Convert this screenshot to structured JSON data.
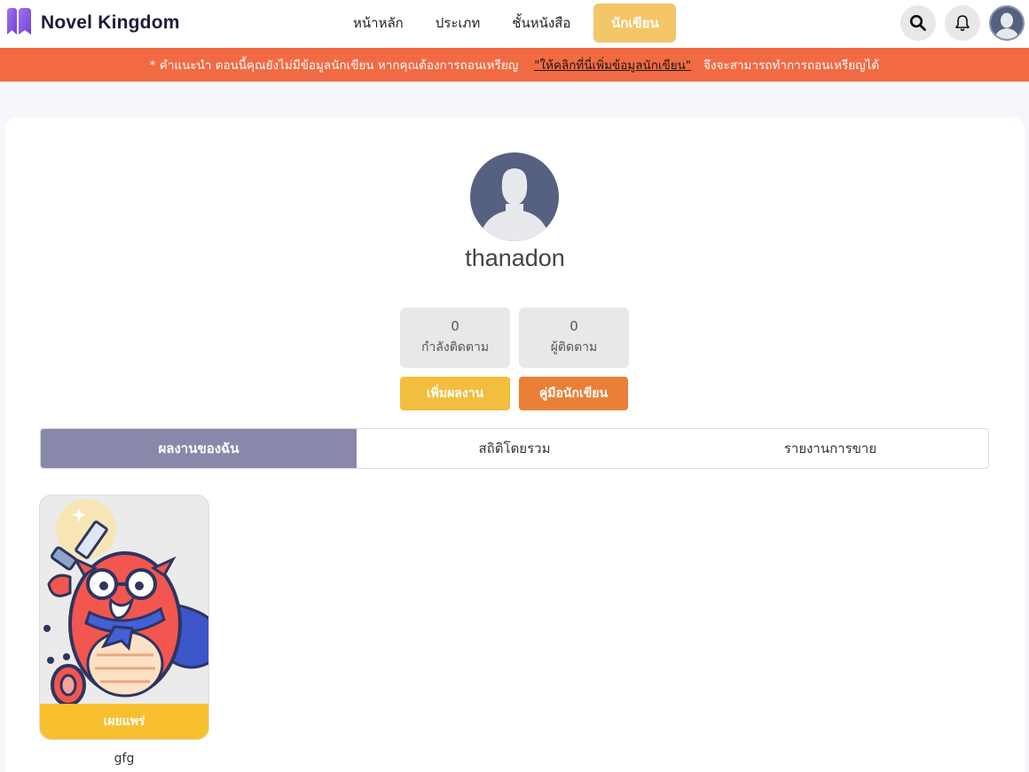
{
  "brand": {
    "name": "Novel Kingdom"
  },
  "nav": {
    "items": [
      {
        "label": "หน้าหลัก"
      },
      {
        "label": "ประเภท"
      },
      {
        "label": "ชั้นหนังสือ"
      },
      {
        "label": "นักเขียน"
      }
    ],
    "active_index": 3
  },
  "header_icons": [
    "search-icon",
    "bell-icon",
    "avatar"
  ],
  "notice": {
    "prefix": "* คำแนะนำ ตอนนี้คุณยังไม่มีข้อมูลนักเขียน หากคุณต้องการถอนเหรียญ",
    "link": "\"ให้คลิกที่นี่เพิ่มข้อมูลนักเขียน\"",
    "suffix": "จึงจะสามารถทำการถอนเหรียญได้"
  },
  "profile": {
    "username": "thanadon",
    "following": {
      "count": "0",
      "label": "กำลังติดตาม"
    },
    "followers": {
      "count": "0",
      "label": "ผู้ติดตาม"
    }
  },
  "actions": {
    "add_work": "เพิ่มผลงาน",
    "writer_guide": "คู่มือนักเขียน"
  },
  "tabs": [
    {
      "label": "ผลงานของฉัน"
    },
    {
      "label": "สถิติโดยรวม"
    },
    {
      "label": "รายงานการขาย"
    }
  ],
  "active_tab": 0,
  "books": [
    {
      "title": "gfg",
      "status": "เผยแพร่"
    }
  ],
  "colors": {
    "accent_yellow": "#f3c667",
    "notice_orange": "#f26a43",
    "button_yellow": "#f3bd3e",
    "button_orange": "#ea7f38",
    "tab_active": "#8889aa",
    "status_badge": "#f8c02f",
    "brand_purple": "#8b5cf6"
  }
}
